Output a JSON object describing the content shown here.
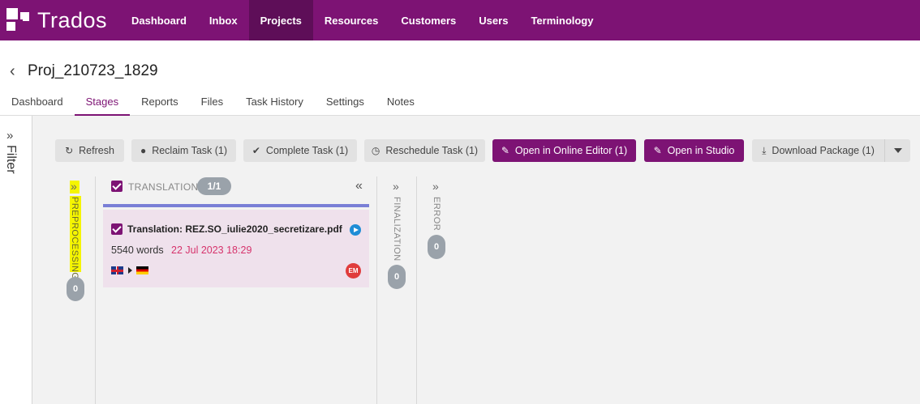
{
  "brand": {
    "name": "Trados"
  },
  "nav": {
    "items": [
      "Dashboard",
      "Inbox",
      "Projects",
      "Resources",
      "Customers",
      "Users",
      "Terminology"
    ],
    "active": "Projects"
  },
  "project": {
    "title": "Proj_210723_1829"
  },
  "tabs": {
    "items": [
      "Dashboard",
      "Stages",
      "Reports",
      "Files",
      "Task History",
      "Settings",
      "Notes"
    ],
    "active": "Stages"
  },
  "filter": {
    "label": "Filter"
  },
  "toolbar": {
    "refresh": "Refresh",
    "reclaim": "Reclaim Task (1)",
    "complete": "Complete Task (1)",
    "reschedule": "Reschedule Task (1)",
    "open_online": "Open in Online Editor (1)",
    "open_studio": "Open in Studio",
    "download": "Download Package (1)"
  },
  "stages": {
    "preprocessing": {
      "label": "PREPROCESSING",
      "count": "0"
    },
    "translation": {
      "label": "TRANSLATION",
      "count": "1/1"
    },
    "finalization": {
      "label": "FINALIZATION",
      "count": "0"
    },
    "error": {
      "label": "ERROR",
      "count": "0"
    }
  },
  "task": {
    "title": "Translation: REZ.SO_iulie2020_secretizare.pdf",
    "words": "5540 words",
    "due": "22 Jul 2023 18:29",
    "source_flag": "uk-flag-icon",
    "target_flag": "germany-flag-icon",
    "assignee": "EM"
  },
  "colors": {
    "brand": "#7d1374",
    "stage_line": "#7a7fd6",
    "card_bg": "#efe1ec",
    "due_date": "#d6336c",
    "highlight": "#f5f500"
  }
}
